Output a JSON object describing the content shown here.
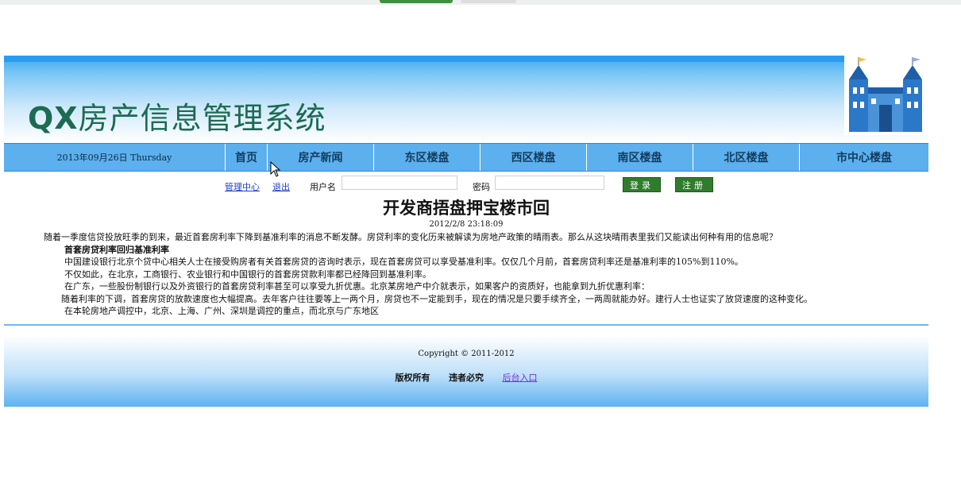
{
  "site": {
    "title_latin": "QX",
    "title_cn": "房产信息管理系统"
  },
  "nav": {
    "date": "2013年09月26日  Thursday",
    "items": [
      {
        "label": "首页"
      },
      {
        "label": "房产新闻"
      },
      {
        "label": "东区楼盘"
      },
      {
        "label": "西区楼盘"
      },
      {
        "label": "南区楼盘"
      },
      {
        "label": "北区楼盘"
      },
      {
        "label": "市中心楼盘"
      }
    ]
  },
  "login": {
    "manage_link": "管理中心",
    "logout_link": "退出",
    "username_label": "用户名",
    "username_value": "",
    "password_label": "密码",
    "password_value": "",
    "login_button": "登录",
    "register_button": "注册"
  },
  "article": {
    "title": "开发商捂盘押宝楼市回",
    "date": "2012/2/8 23:18:09",
    "paragraphs": [
      "随着一季度信贷投放旺季的到来，最近首套房利率下降到基准利率的消息不断发酵。房贷利率的变化历来被解读为房地产政策的晴雨表。那么从这块晴雨表里我们又能读出何种有用的信息呢？",
      "首套房贷利率回归基准利率",
      "中国建设银行北京个贷中心相关人士在接受购房者有关首套房贷的咨询时表示，现在首套房贷可以享受基准利率。仅仅几个月前，首套房贷利率还是基准利率的105%到110%。",
      "不仅如此，在北京，工商银行、农业银行和中国银行的首套房贷款利率都已经降回到基准利率。",
      "在广东，一些股份制银行以及外资银行的首套房贷利率甚至可以享受九折优惠。北京某房地产中介就表示，如果客户的资质好，也能拿到九折优惠利率：",
      "随着利率的下调，首套房贷的放款速度也大幅提高。去年客户往往要等上一两个月，房贷也不一定能到手，现在的情况是只要手续齐全，一两周就能办好。建行人士也证实了放贷速度的这种变化。",
      "在本轮房地产调控中，北京、上海、广州、深圳是调控的重点，而北京与广东地区"
    ]
  },
  "footer": {
    "copyright": "Copyright © 2011-2012",
    "rights": "版权所有",
    "piracy": "违者必究",
    "admin_link": "后台入口"
  },
  "colors": {
    "nav_bg": "#5cb0ee",
    "title_green": "#1c6b52",
    "button_green": "#2f7d2c",
    "link_blue": "#1a40c8",
    "admin_link_purple": "#7b2fd6"
  }
}
